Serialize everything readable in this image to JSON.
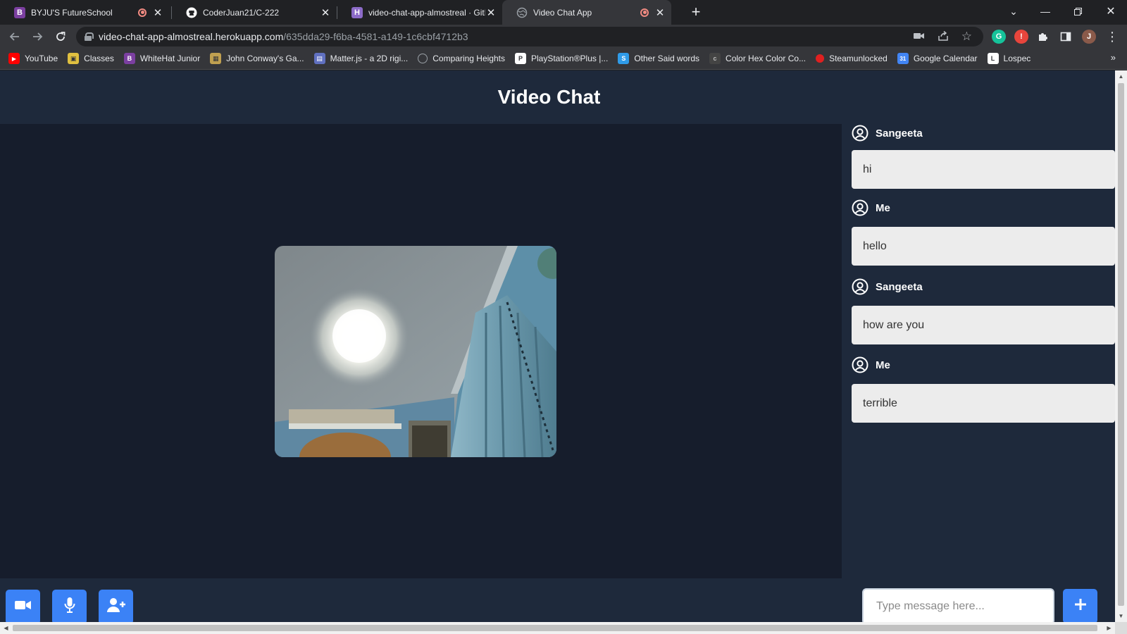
{
  "browser": {
    "tabs": [
      {
        "title": "BYJU'S FutureSchool",
        "favicon": "B",
        "favicon_color": "#7b3fa0",
        "recording": true
      },
      {
        "title": "CoderJuan21/C-222",
        "favicon": "github-icon",
        "favicon_color": "#ffffff",
        "recording": false
      },
      {
        "title": "video-chat-app-almostreal · GitH",
        "favicon": "H",
        "favicon_color": "#8c6bc8",
        "recording": false
      },
      {
        "title": "Video Chat App",
        "favicon": "globe-icon",
        "favicon_color": "#9aa0a6",
        "recording": true
      }
    ],
    "url_host": "video-chat-app-almostreal.herokuapp.com",
    "url_path": "/635dda29-f6ba-4581-a149-1c6cbf4712b3",
    "profile_initial": "J",
    "bookmarks": [
      {
        "label": "YouTube",
        "icon": "youtube-icon",
        "color": "#ff0000"
      },
      {
        "label": "Classes",
        "icon": "classes-icon",
        "color": "#e0c040"
      },
      {
        "label": "WhiteHat Junior",
        "icon": "whitehat-icon",
        "color": "#7b3fa0"
      },
      {
        "label": "John Conway's Ga...",
        "icon": "game-of-life-icon",
        "color": "#c0a050"
      },
      {
        "label": "Matter.js - a 2D rigi...",
        "icon": "matterjs-icon",
        "color": "#6070c0"
      },
      {
        "label": "Comparing Heights",
        "icon": "globe-icon",
        "color": "#9aa0a6"
      },
      {
        "label": "PlayStation®Plus |...",
        "icon": "playstation-icon",
        "color": "#ffffff"
      },
      {
        "label": "Other Said words",
        "icon": "other-said-icon",
        "color": "#2f9be8"
      },
      {
        "label": "Color Hex Color Co...",
        "icon": "colorhex-icon",
        "color": "#444444"
      },
      {
        "label": "Steamunlocked",
        "icon": "steamunlocked-icon",
        "color": "#e02020"
      },
      {
        "label": "Google Calendar",
        "icon": "calendar-icon",
        "color": "#4285f4"
      },
      {
        "label": "Lospec",
        "icon": "lospec-icon",
        "color": "#ffffff"
      }
    ]
  },
  "app": {
    "title": "Video Chat",
    "accent_color": "#3b82f6",
    "controls": [
      {
        "name": "video-toggle-button",
        "icon": "video-camera-icon"
      },
      {
        "name": "mic-toggle-button",
        "icon": "microphone-icon"
      },
      {
        "name": "invite-user-button",
        "icon": "user-plus-icon"
      }
    ],
    "messages": [
      {
        "sender": "Sangeeta",
        "text": "hi"
      },
      {
        "sender": "Me",
        "text": "hello"
      },
      {
        "sender": "Sangeeta",
        "text": "how are you"
      },
      {
        "sender": "Me",
        "text": "terrible"
      }
    ],
    "chat_input": {
      "placeholder": "Type message here...",
      "value": ""
    },
    "send_icon": "plus-icon"
  }
}
